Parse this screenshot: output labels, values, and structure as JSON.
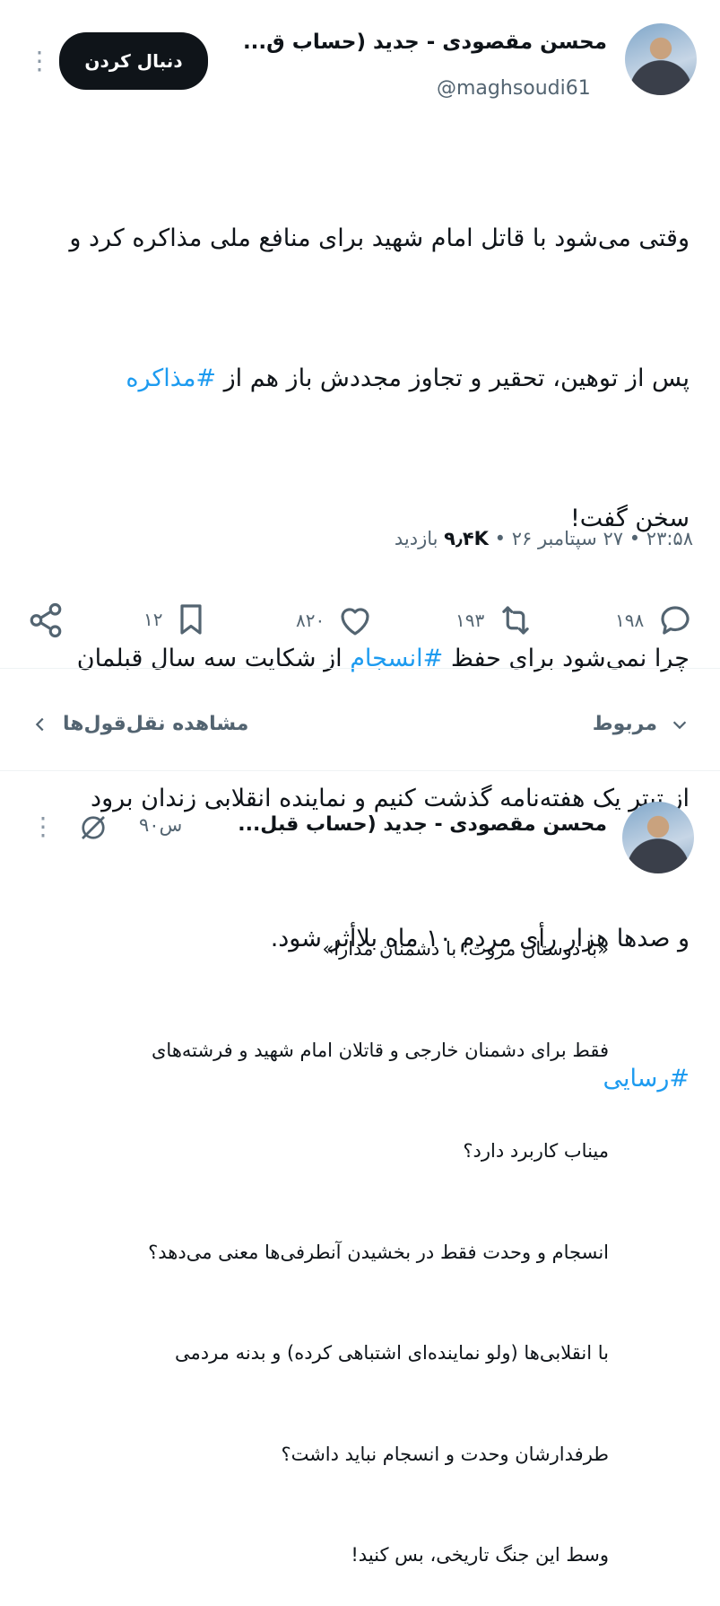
{
  "main_tweet": {
    "author_name": "محسن مقصودی - جدید (حساب ق...",
    "handle": "@maghsoudi61",
    "follow_label": "دنبال کردن",
    "more_label": "⋮",
    "text_lines": [
      "وقتی می‌شود با قاتل امام شهید برای منافع ملی مذاکره کرد و",
      "پس از توهین، تحقیر و تجاوز مجددش باز هم از ",
      "سخن گفت!",
      "چرا نمی‌شود برای حفظ ",
      "از تیتر یک هفته‌نامه گذشت کنیم و نماینده انقلابی زندان برود",
      "و صدها هزار رأی مردم ۱۰ ماه بلاأثر شود."
    ],
    "hashtag_mozakere": "#مذاکره",
    "hashtag_ensejam": "#انسجام",
    "line4_tail": " از شکایت سه سال قبلمان",
    "hashtag_rosvayi": "#رسایی",
    "time": "۲۳:۵۸",
    "date": "۲۷ سپتامبر ۲۶",
    "views_count": "۹٫۴K",
    "views_label": "بازدید",
    "sep": "•"
  },
  "actions": {
    "replies": "۱۹۸",
    "retweets": "۱۹۳",
    "likes": "۸۲۰",
    "bookmarks": "۱۲"
  },
  "sub_bar": {
    "related_label": "مربوط",
    "quotes_label": "مشاهده نقل‌قول‌ها"
  },
  "quoted_tweet": {
    "author_name": "محسن مقصودی - جدید (حساب قبل...",
    "time_ago": "۹۰س",
    "more_label": "⋮",
    "text_lines": [
      "«با دوستان مروت؛ با دشمنان مدارا»",
      "فقط برای دشمنان خارجی و قاتلان امام شهید و فرشته‌های",
      "میناب کاربرد دارد؟",
      "انسجام و وحدت فقط در بخشیدن آنطرفی‌ها معنی می‌دهد؟",
      "با انقلابی‌ها (ولو نماینده‌ای اشتباهی کرده) و بدنه مردمی",
      "طرفدارشان وحدت و انسجام نباید داشت؟",
      "وسط این جنگ تاریخی، بس کنید!"
    ]
  },
  "colors": {
    "accent": "#1d9bf0",
    "text": "#0f1419",
    "muted": "#536471"
  }
}
